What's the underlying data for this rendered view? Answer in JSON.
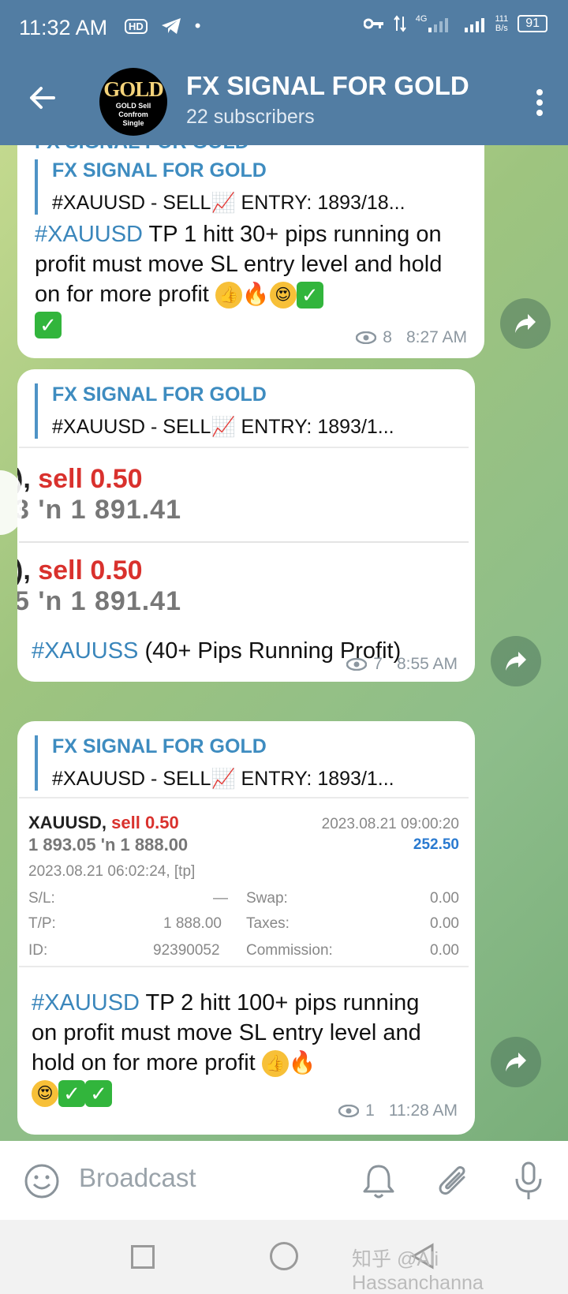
{
  "status_bar": {
    "time": "11:32 AM",
    "network": "4G",
    "speed_top": "111",
    "speed_bottom": "B/s",
    "battery": "91"
  },
  "header": {
    "title": "FX SIGNAL FOR GOLD",
    "subtitle": "22 subscribers",
    "avatar_big": "GOLD",
    "avatar_line1": "GOLD Sell",
    "avatar_line2": "Confrom",
    "avatar_line3": "Single"
  },
  "messages": [
    {
      "partial_top": "FX SIGNAL FOR GOLD",
      "quote_title": "FX SIGNAL FOR GOLD",
      "quote_text": "#XAUUSD   - SELL📈     ENTRY:  1893/18...",
      "tag": "#XAUUSD",
      "text": "  TP 1  hitt 30+ pips running on profit must move SL entry level and hold on for more profit",
      "views": "8",
      "time": "8:27 AM"
    },
    {
      "quote_title": "FX SIGNAL FOR GOLD",
      "quote_text": "#XAUUSD   - SELL📈     ENTRY:  1893/1...",
      "trade1_prefix": "), ",
      "trade1_sell": "sell 0.50",
      "trade1_price": "3 'n   1 891.41",
      "trade2_prefix": "), ",
      "trade2_sell": "sell 0.50",
      "trade2_price": "5 'n   1 891.41",
      "tag": "#XAUUSS",
      "text": "  (40+ Pips  Running Profit)",
      "views": "7",
      "time": "8:55 AM"
    },
    {
      "quote_title": "FX SIGNAL FOR GOLD",
      "quote_text": "#XAUUSD   - SELL📈     ENTRY:  1893/1...",
      "trade": {
        "symbol": "XAUUSD,",
        "sell": "sell 0.50",
        "close_time": "2023.08.21 09:00:20",
        "prices": "1 893.05 'n  1 888.00",
        "profit": "252.50",
        "open_time": "2023.08.21 06:02:24, [tp]",
        "sl_label": "S/L:",
        "sl_value": "—",
        "tp_label": "T/P:",
        "tp_value": "1 888.00",
        "id_label": "ID:",
        "id_value": "92390052",
        "swap_label": "Swap:",
        "swap_value": "0.00",
        "taxes_label": "Taxes:",
        "taxes_value": "0.00",
        "commission_label": "Commission:",
        "commission_value": "0.00"
      },
      "tag": "#XAUUSD",
      "text": "  TP 2  hitt 100+ pips running on profit must move SL entry level and hold on for more profit",
      "views": "1",
      "time": "11:28 AM"
    }
  ],
  "composer": {
    "placeholder": "Broadcast"
  },
  "watermark": "知乎 @Ali Hassanchanna",
  "icons": [
    "back-arrow-icon",
    "more-vert-icon",
    "share-icon",
    "eye-icon",
    "emoji-icon",
    "bell-icon",
    "paperclip-icon",
    "mic-icon"
  ]
}
